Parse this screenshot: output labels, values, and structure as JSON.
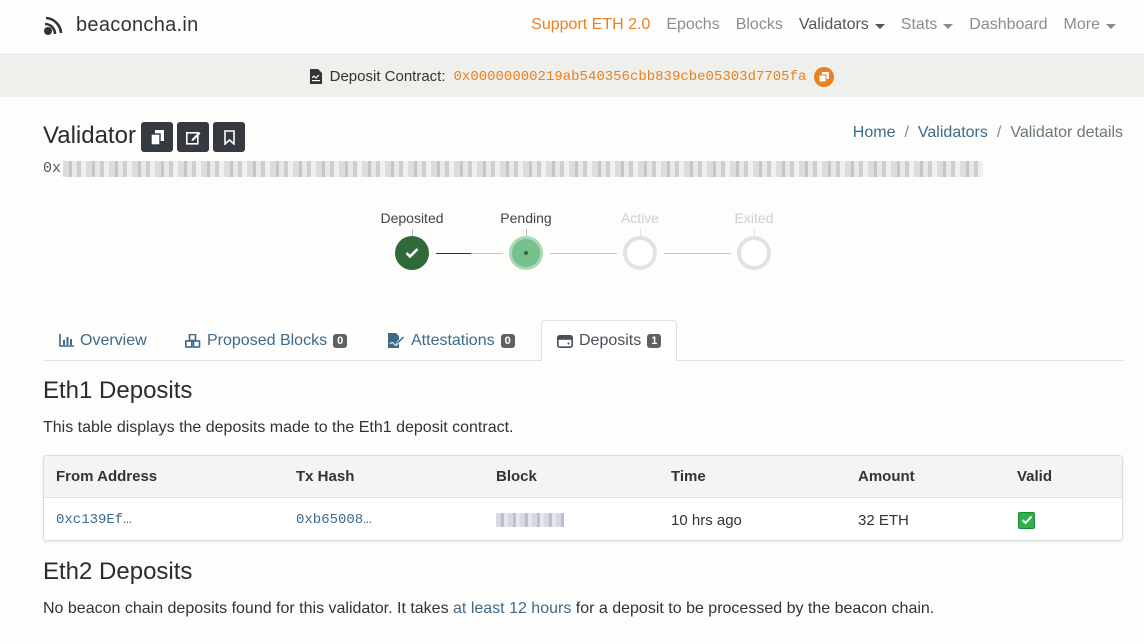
{
  "brand": {
    "name": "beaconcha.in",
    "icon": "satellite-dish-icon"
  },
  "nav": {
    "support": "Support ETH 2.0",
    "epochs": "Epochs",
    "blocks": "Blocks",
    "validators": "Validators",
    "stats": "Stats",
    "dashboard": "Dashboard",
    "more": "More"
  },
  "deposit_bar": {
    "label": "Deposit Contract:",
    "address": "0x00000000219ab540356cbb839cbe05303d7705fa"
  },
  "header": {
    "title": "Validator",
    "pubkey_prefix": "0x"
  },
  "breadcrumb": {
    "home": "Home",
    "sep": "/",
    "validators": "Validators",
    "current": "Validator details"
  },
  "status_steps": {
    "deposited": "Deposited",
    "pending": "Pending",
    "active": "Active",
    "exited": "Exited"
  },
  "tabs": {
    "overview": "Overview",
    "proposed_blocks": "Proposed Blocks",
    "proposed_blocks_count": "0",
    "attestations": "Attestations",
    "attestations_count": "0",
    "deposits": "Deposits",
    "deposits_count": "1"
  },
  "eth1": {
    "title": "Eth1 Deposits",
    "description": "This table displays the deposits made to the Eth1 deposit contract.",
    "columns": {
      "from": "From Address",
      "tx": "Tx Hash",
      "block": "Block",
      "time": "Time",
      "amount": "Amount",
      "valid": "Valid"
    },
    "row": {
      "from": "0xc139Ef…",
      "tx": "0xb65008…",
      "time": "10 hrs ago",
      "amount": "32 ETH"
    }
  },
  "eth2": {
    "title": "Eth2 Deposits",
    "desc_before": "No beacon chain deposits found for this validator. It takes ",
    "desc_link": "at least 12 hours",
    "desc_after": " for a deposit to be processed by the beacon chain."
  },
  "colors": {
    "accent": "#e8821e",
    "link": "#3e6a8a",
    "success": "#2f6a38"
  }
}
